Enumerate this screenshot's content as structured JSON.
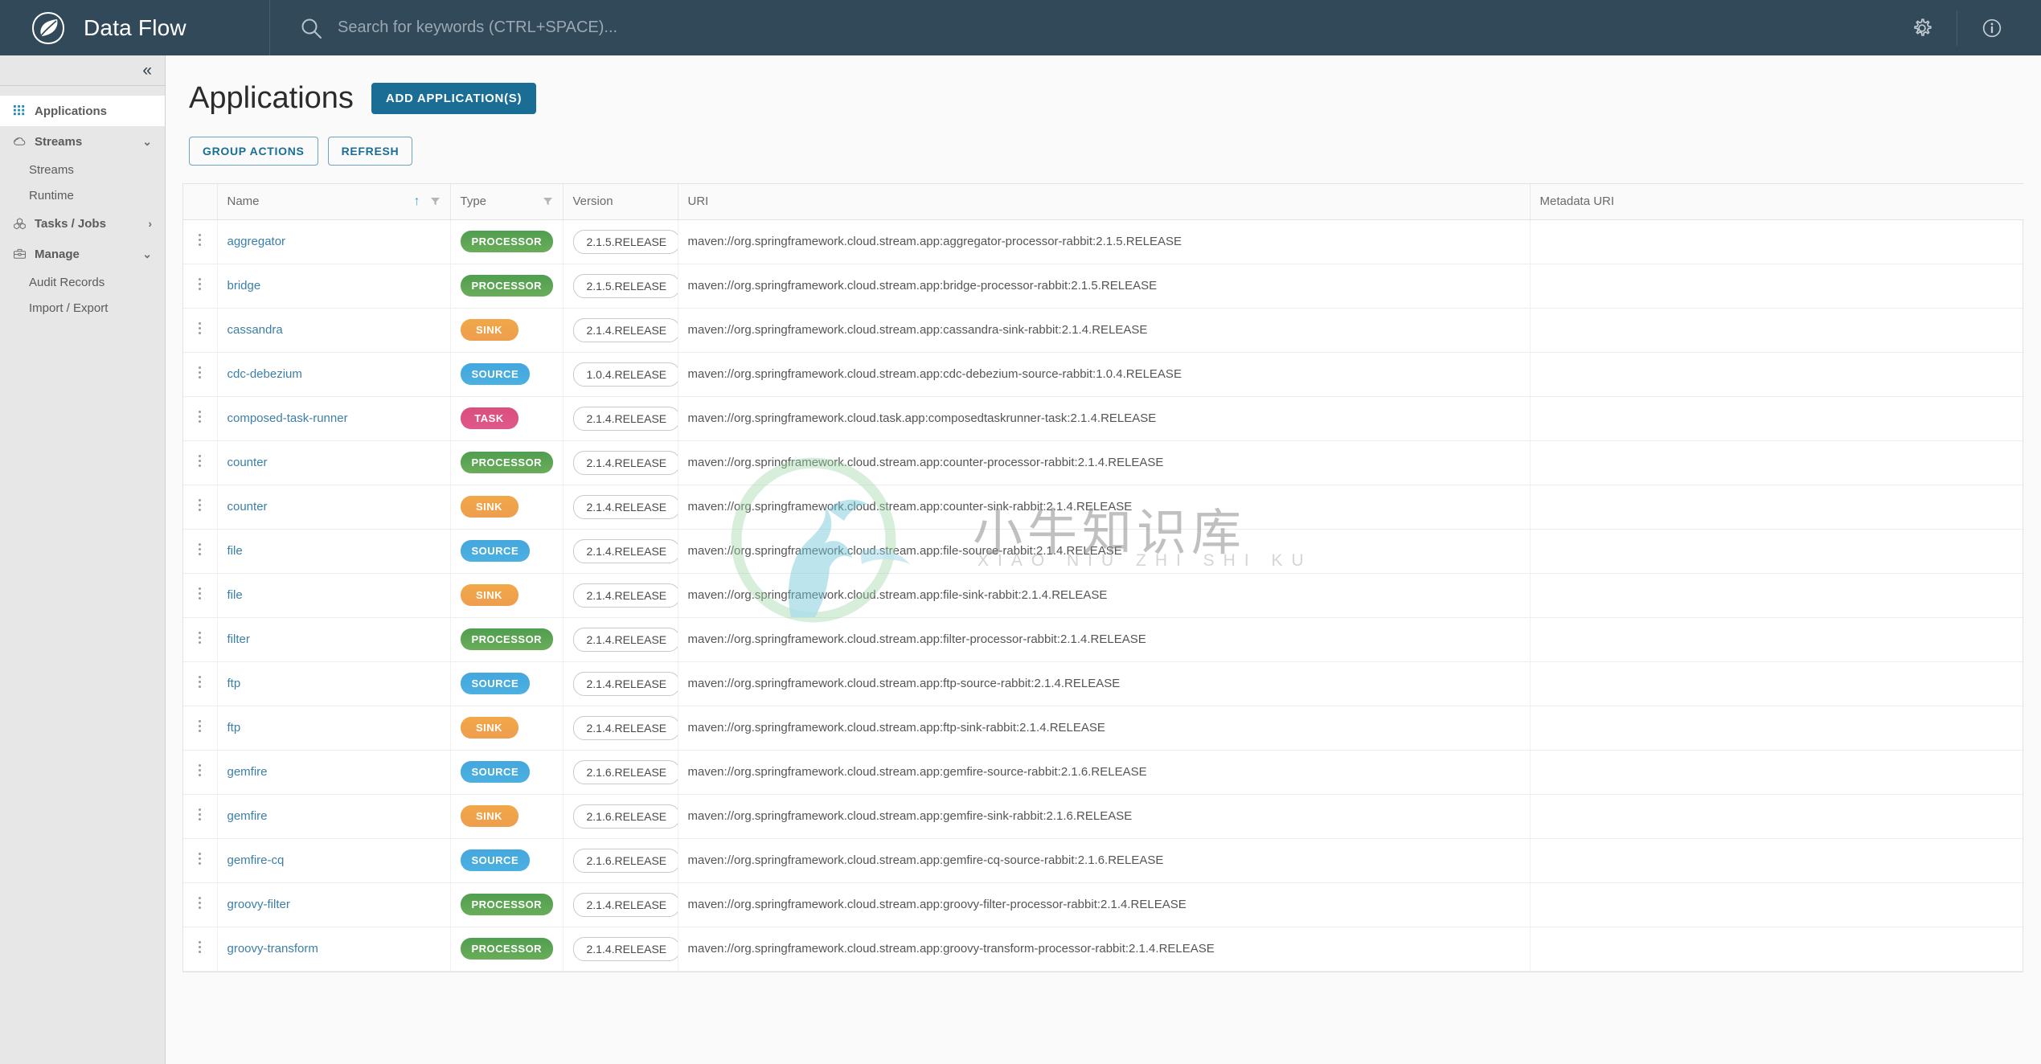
{
  "topbar": {
    "brand_title": "Data Flow",
    "logo_icon": "spring-leaf-logo",
    "search_icon": "search-icon",
    "search_value": "",
    "search_placeholder": "Search for keywords (CTRL+SPACE)...",
    "settings_icon": "gear-icon",
    "about_icon": "info-circle-icon"
  },
  "sidebar": {
    "collapse_icon": "double-chevron-left-icon",
    "items": [
      {
        "label": "Applications",
        "icon": "grid-dots-icon",
        "active": true,
        "type": "item",
        "chevron": ""
      },
      {
        "label": "Streams",
        "icon": "cloud-icon",
        "active": false,
        "type": "group",
        "chevron": "⌄"
      },
      {
        "label": "Streams",
        "icon": "",
        "active": false,
        "type": "sub",
        "chevron": ""
      },
      {
        "label": "Runtime",
        "icon": "",
        "active": false,
        "type": "sub",
        "chevron": ""
      },
      {
        "label": "Tasks / Jobs",
        "icon": "cubes-icon",
        "active": false,
        "type": "group",
        "chevron": "›"
      },
      {
        "label": "Manage",
        "icon": "briefcase-icon",
        "active": false,
        "type": "group",
        "chevron": "⌄"
      },
      {
        "label": "Audit Records",
        "icon": "",
        "active": false,
        "type": "sub",
        "chevron": ""
      },
      {
        "label": "Import / Export",
        "icon": "",
        "active": false,
        "type": "sub",
        "chevron": ""
      }
    ]
  },
  "page": {
    "title": "Applications",
    "add_button": "ADD APPLICATION(S)",
    "group_actions_button": "GROUP ACTIONS",
    "refresh_button": "REFRESH"
  },
  "table": {
    "columns": [
      {
        "label": "Name",
        "sort": "asc",
        "filter": true
      },
      {
        "label": "Type",
        "sort": "none",
        "filter": true
      },
      {
        "label": "Version",
        "sort": "none",
        "filter": false
      },
      {
        "label": "URI",
        "sort": "none",
        "filter": false
      },
      {
        "label": "Metadata URI",
        "sort": "none",
        "filter": false
      }
    ],
    "sort_asc_glyph": "↑",
    "menu_icon": "kebab-menu-icon",
    "rows": [
      {
        "name": "aggregator",
        "type": "PROCESSOR",
        "type_class": "processor",
        "version": "2.1.5.RELEASE",
        "uri": "maven://org.springframework.cloud.stream.app:aggregator-processor-rabbit:2.1.5.RELEASE",
        "metadata_uri": ""
      },
      {
        "name": "bridge",
        "type": "PROCESSOR",
        "type_class": "processor",
        "version": "2.1.5.RELEASE",
        "uri": "maven://org.springframework.cloud.stream.app:bridge-processor-rabbit:2.1.5.RELEASE",
        "metadata_uri": ""
      },
      {
        "name": "cassandra",
        "type": "SINK",
        "type_class": "sink",
        "version": "2.1.4.RELEASE",
        "uri": "maven://org.springframework.cloud.stream.app:cassandra-sink-rabbit:2.1.4.RELEASE",
        "metadata_uri": ""
      },
      {
        "name": "cdc-debezium",
        "type": "SOURCE",
        "type_class": "source",
        "version": "1.0.4.RELEASE",
        "uri": "maven://org.springframework.cloud.stream.app:cdc-debezium-source-rabbit:1.0.4.RELEASE",
        "metadata_uri": ""
      },
      {
        "name": "composed-task-runner",
        "type": "TASK",
        "type_class": "task",
        "version": "2.1.4.RELEASE",
        "uri": "maven://org.springframework.cloud.task.app:composedtaskrunner-task:2.1.4.RELEASE",
        "metadata_uri": ""
      },
      {
        "name": "counter",
        "type": "PROCESSOR",
        "type_class": "processor",
        "version": "2.1.4.RELEASE",
        "uri": "maven://org.springframework.cloud.stream.app:counter-processor-rabbit:2.1.4.RELEASE",
        "metadata_uri": ""
      },
      {
        "name": "counter",
        "type": "SINK",
        "type_class": "sink",
        "version": "2.1.4.RELEASE",
        "uri": "maven://org.springframework.cloud.stream.app:counter-sink-rabbit:2.1.4.RELEASE",
        "metadata_uri": ""
      },
      {
        "name": "file",
        "type": "SOURCE",
        "type_class": "source",
        "version": "2.1.4.RELEASE",
        "uri": "maven://org.springframework.cloud.stream.app:file-source-rabbit:2.1.4.RELEASE",
        "metadata_uri": ""
      },
      {
        "name": "file",
        "type": "SINK",
        "type_class": "sink",
        "version": "2.1.4.RELEASE",
        "uri": "maven://org.springframework.cloud.stream.app:file-sink-rabbit:2.1.4.RELEASE",
        "metadata_uri": ""
      },
      {
        "name": "filter",
        "type": "PROCESSOR",
        "type_class": "processor",
        "version": "2.1.4.RELEASE",
        "uri": "maven://org.springframework.cloud.stream.app:filter-processor-rabbit:2.1.4.RELEASE",
        "metadata_uri": ""
      },
      {
        "name": "ftp",
        "type": "SOURCE",
        "type_class": "source",
        "version": "2.1.4.RELEASE",
        "uri": "maven://org.springframework.cloud.stream.app:ftp-source-rabbit:2.1.4.RELEASE",
        "metadata_uri": ""
      },
      {
        "name": "ftp",
        "type": "SINK",
        "type_class": "sink",
        "version": "2.1.4.RELEASE",
        "uri": "maven://org.springframework.cloud.stream.app:ftp-sink-rabbit:2.1.4.RELEASE",
        "metadata_uri": ""
      },
      {
        "name": "gemfire",
        "type": "SOURCE",
        "type_class": "source",
        "version": "2.1.6.RELEASE",
        "uri": "maven://org.springframework.cloud.stream.app:gemfire-source-rabbit:2.1.6.RELEASE",
        "metadata_uri": ""
      },
      {
        "name": "gemfire",
        "type": "SINK",
        "type_class": "sink",
        "version": "2.1.6.RELEASE",
        "uri": "maven://org.springframework.cloud.stream.app:gemfire-sink-rabbit:2.1.6.RELEASE",
        "metadata_uri": ""
      },
      {
        "name": "gemfire-cq",
        "type": "SOURCE",
        "type_class": "source",
        "version": "2.1.6.RELEASE",
        "uri": "maven://org.springframework.cloud.stream.app:gemfire-cq-source-rabbit:2.1.6.RELEASE",
        "metadata_uri": ""
      },
      {
        "name": "groovy-filter",
        "type": "PROCESSOR",
        "type_class": "processor",
        "version": "2.1.4.RELEASE",
        "uri": "maven://org.springframework.cloud.stream.app:groovy-filter-processor-rabbit:2.1.4.RELEASE",
        "metadata_uri": ""
      },
      {
        "name": "groovy-transform",
        "type": "PROCESSOR",
        "type_class": "processor",
        "version": "2.1.4.RELEASE",
        "uri": "maven://org.springframework.cloud.stream.app:groovy-transform-processor-rabbit:2.1.4.RELEASE",
        "metadata_uri": ""
      }
    ]
  },
  "watermark": {
    "text": "小牛知识库",
    "subtext": "XIAO NIU ZHI SHI KU"
  },
  "colors": {
    "topbar_bg": "#32495a",
    "accent": "#1a6e96",
    "link": "#3b7fa8",
    "processor": "#5aa455",
    "sink": "#ef9d4e",
    "source": "#44a7de",
    "task": "#d94f7c"
  }
}
